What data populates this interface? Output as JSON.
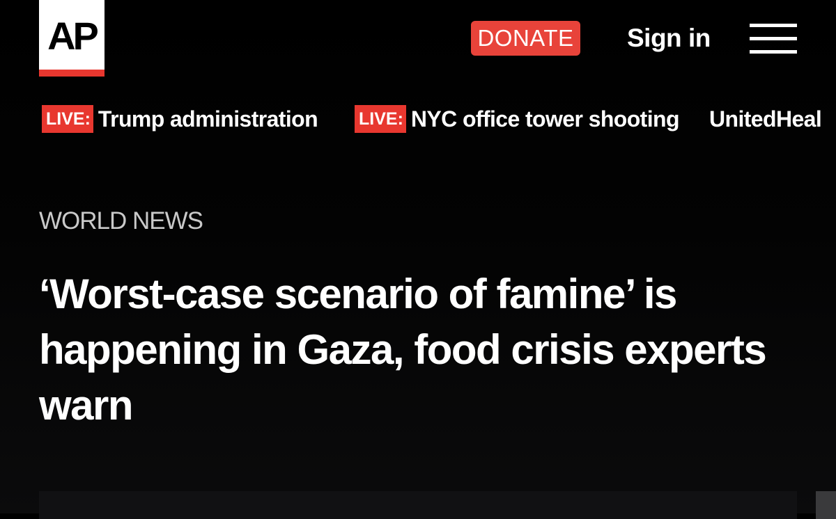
{
  "header": {
    "logo_text": "AP",
    "donate_label": "DONATE",
    "signin_label": "Sign in",
    "menu_icon": "hamburger-menu-icon"
  },
  "ticker": [
    {
      "badge": "LIVE:",
      "text": "Trump administration"
    },
    {
      "badge": "LIVE:",
      "text": "NYC office tower shooting"
    },
    {
      "badge": "",
      "text": "UnitedHeal"
    }
  ],
  "article": {
    "section": "WORLD NEWS",
    "headline": "‘Worst-case scenario of famine’ is happening in Gaza, food crisis experts warn"
  },
  "colors": {
    "accent_red": "#e8372f",
    "background": "#000000",
    "text": "#ffffff",
    "section_label": "#c9c9c9"
  }
}
